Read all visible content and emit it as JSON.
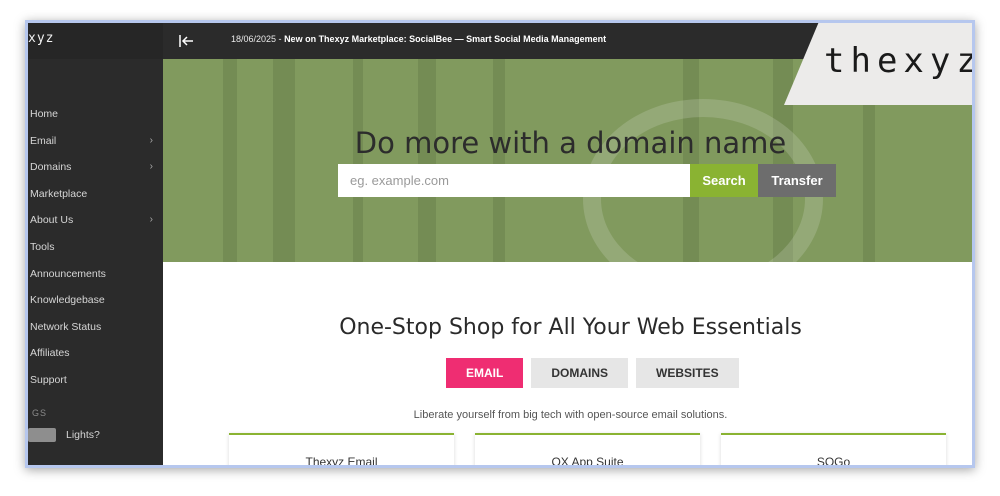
{
  "sidebar": {
    "logo_text": "xyz",
    "items": [
      {
        "label": "Home",
        "has_children": false
      },
      {
        "label": "Email",
        "has_children": true
      },
      {
        "label": "Domains",
        "has_children": true
      },
      {
        "label": "Marketplace",
        "has_children": false
      },
      {
        "label": "About Us",
        "has_children": true
      },
      {
        "label": "Tools",
        "has_children": false
      },
      {
        "label": "Announcements",
        "has_children": false
      },
      {
        "label": "Knowledgebase",
        "has_children": false
      },
      {
        "label": "Network Status",
        "has_children": false
      },
      {
        "label": "Affiliates",
        "has_children": false
      },
      {
        "label": "Support",
        "has_children": false
      }
    ],
    "section_label": "GS",
    "lights_label": "Lights?"
  },
  "topbar": {
    "announcement_date": "18/06/2025 -",
    "announcement_text": "New on Thexyz Marketplace: SocialBee — Smart Social Media Management"
  },
  "logo": {
    "text": "thexyz"
  },
  "hero": {
    "title": "Do more with a domain name",
    "search_placeholder": "eg. example.com",
    "search_button": "Search",
    "transfer_button": "Transfer"
  },
  "content": {
    "title": "One-Stop Shop for All Your Web Essentials",
    "tabs": [
      {
        "label": "EMAIL",
        "active": true
      },
      {
        "label": "DOMAINS",
        "active": false
      },
      {
        "label": "WEBSITES",
        "active": false
      }
    ],
    "tagline": "Liberate yourself from big tech with open-source email solutions.",
    "cards": [
      {
        "title": "Thexyz Email"
      },
      {
        "title": "OX App Suite"
      },
      {
        "title": "SOGo"
      }
    ]
  },
  "colors": {
    "accent_green": "#8ab332",
    "accent_pink": "#ef2d72",
    "hero_bg": "#819a5e",
    "sidebar_bg": "#2b2b2b"
  }
}
